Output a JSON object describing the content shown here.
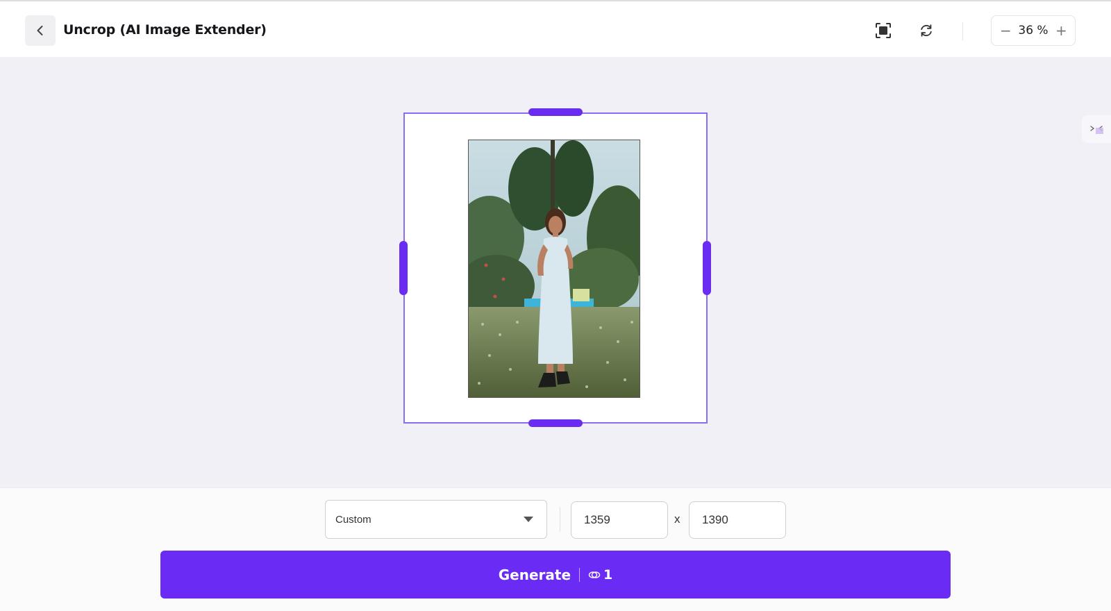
{
  "header": {
    "title": "Uncrop (AI Image Extender)",
    "zoom_value": "36 %",
    "zoom_minus": "−",
    "zoom_plus": "+"
  },
  "icons": {
    "back": "chevron-left-icon",
    "fit": "fit-screen-icon",
    "reset": "refresh-icon",
    "side": "collapse-panel-icon",
    "credit": "coin-icon"
  },
  "controls": {
    "aspect_ratio": "Custom",
    "width": "1359",
    "height": "1390",
    "separator": "x",
    "generate_label": "Generate",
    "credit_cost": "1"
  },
  "colors": {
    "accent": "#6a2cf5",
    "frame_border": "#8a6cf2",
    "handle": "#6b2cf1"
  }
}
